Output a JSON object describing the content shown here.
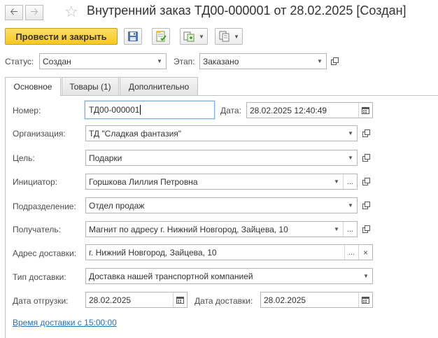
{
  "window": {
    "title": "Внутренний заказ ТД00-000001 от 28.02.2025 [Создан]",
    "back_icon": "arrow-left",
    "forward_icon": "arrow-right",
    "favorite_icon": "star-outline"
  },
  "toolbar": {
    "post_and_close": "Провести и закрыть",
    "save_icon": "floppy-disk",
    "post_icon": "document-post",
    "create_based_icon": "create-based-on",
    "print_icon": "print-forms"
  },
  "status": {
    "status_label": "Статус:",
    "status_value": "Создан",
    "stage_label": "Этап:",
    "stage_value": "Заказано"
  },
  "tabs": [
    {
      "label": "Основное",
      "active": true
    },
    {
      "label": "Товары (1)",
      "active": false
    },
    {
      "label": "Дополнительно",
      "active": false
    }
  ],
  "form": {
    "number_label": "Номер:",
    "number_value": "ТД00-000001",
    "date_label": "Дата:",
    "date_value": "28.02.2025 12:40:49",
    "org_label": "Организация:",
    "org_value": "ТД \"Сладкая фантазия\"",
    "goal_label": "Цель:",
    "goal_value": "Подарки",
    "initiator_label": "Инициатор:",
    "initiator_value": "Горшкова Лиллия Петровна",
    "dept_label": "Подразделение:",
    "dept_value": "Отдел продаж",
    "recipient_label": "Получатель:",
    "recipient_value": "Магнит по адресу г. Нижний Новгород, Зайцева, 10",
    "address_label": "Адрес доставки:",
    "address_value": "г. Нижний Новгород, Зайцева, 10",
    "delivery_type_label": "Тип доставки:",
    "delivery_type_value": "Доставка нашей транспортной компанией",
    "ship_date_label": "Дата отгрузки:",
    "ship_date_value": "28.02.2025",
    "delivery_date_label": "Дата доставки:",
    "delivery_date_value": "28.02.2025",
    "delivery_time_link": "Время доставки с 15:00:00"
  }
}
